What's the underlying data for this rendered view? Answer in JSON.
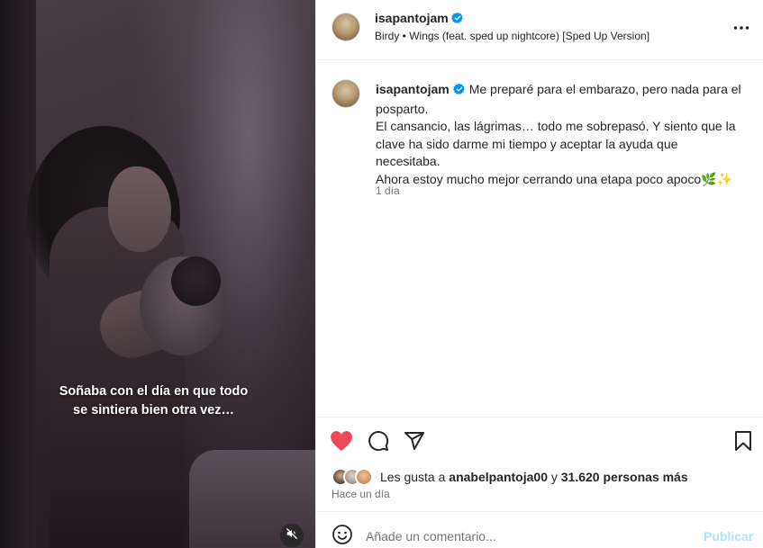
{
  "post": {
    "username": "isapantojam",
    "audio_track": "Birdy • Wings (feat. sped up nightcore) [Sped Up Version]",
    "video_caption": "Soñaba con el día en que todo\nse sintiera bien otra vez…",
    "caption": {
      "first_line": "Me preparé para el embarazo, pero nada para el",
      "lines": [
        "posparto.",
        "El cansancio, las lágrimas… todo me sobrepasó. Y siento que la",
        "clave ha sido darme mi tiempo y aceptar la ayuda que",
        "necesitaba.",
        "Ahora estoy mucho mejor cerrando una etapa poco apoco🌿✨"
      ],
      "age": "1 día"
    },
    "likes": {
      "prefix": "Les gusta a ",
      "liker": "anabelpantoja00",
      "conjunction": " y ",
      "others": "31.620 personas más"
    },
    "date_label": "Hace un día"
  },
  "comment_box": {
    "placeholder": "Añade un comentario...",
    "publish_label": "Publicar"
  },
  "icons": {
    "verified": "verified-badge-icon",
    "more": "more-options-icon",
    "like": "heart-icon",
    "comment": "comment-bubble-icon",
    "share": "paper-plane-icon",
    "save": "bookmark-icon",
    "emoji": "smiley-icon",
    "mute": "muted-speaker-icon"
  },
  "colors": {
    "like_active": "#ed4956",
    "verified": "#0095f6",
    "publish_disabled": "#b2dffc",
    "secondary_text": "#737373"
  },
  "state": {
    "liked": true,
    "muted": true
  }
}
